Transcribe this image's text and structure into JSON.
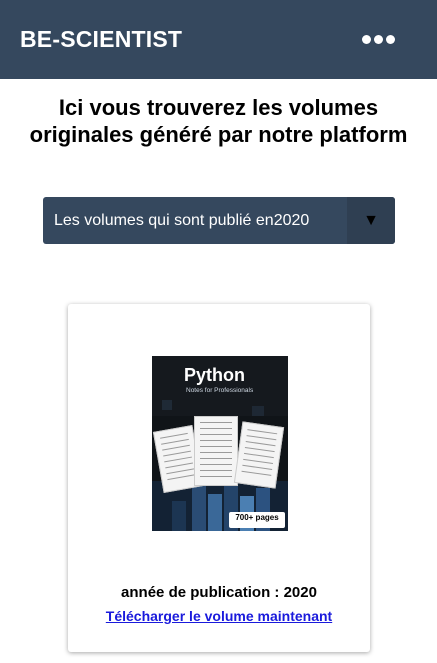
{
  "navbar": {
    "brand": "BE-SCIENTIST",
    "menu_icon": "more-dots-icon"
  },
  "heading": {
    "line1": "Ici vous trouverez les volumes",
    "line2": "originales généré par notre platform"
  },
  "filter": {
    "selected": "Les volumes qui sont publié en2020",
    "arrow_icon": "triangle-down-icon"
  },
  "volume": {
    "cover": {
      "title": "Python",
      "subtitle": "Notes for Professionals",
      "badge": "700+ pages"
    },
    "year_label": "année de publication : 2020",
    "download_link": "Télécharger le volume maintenant"
  },
  "colors": {
    "navbar": "#35485e",
    "link": "#1a1adc"
  }
}
